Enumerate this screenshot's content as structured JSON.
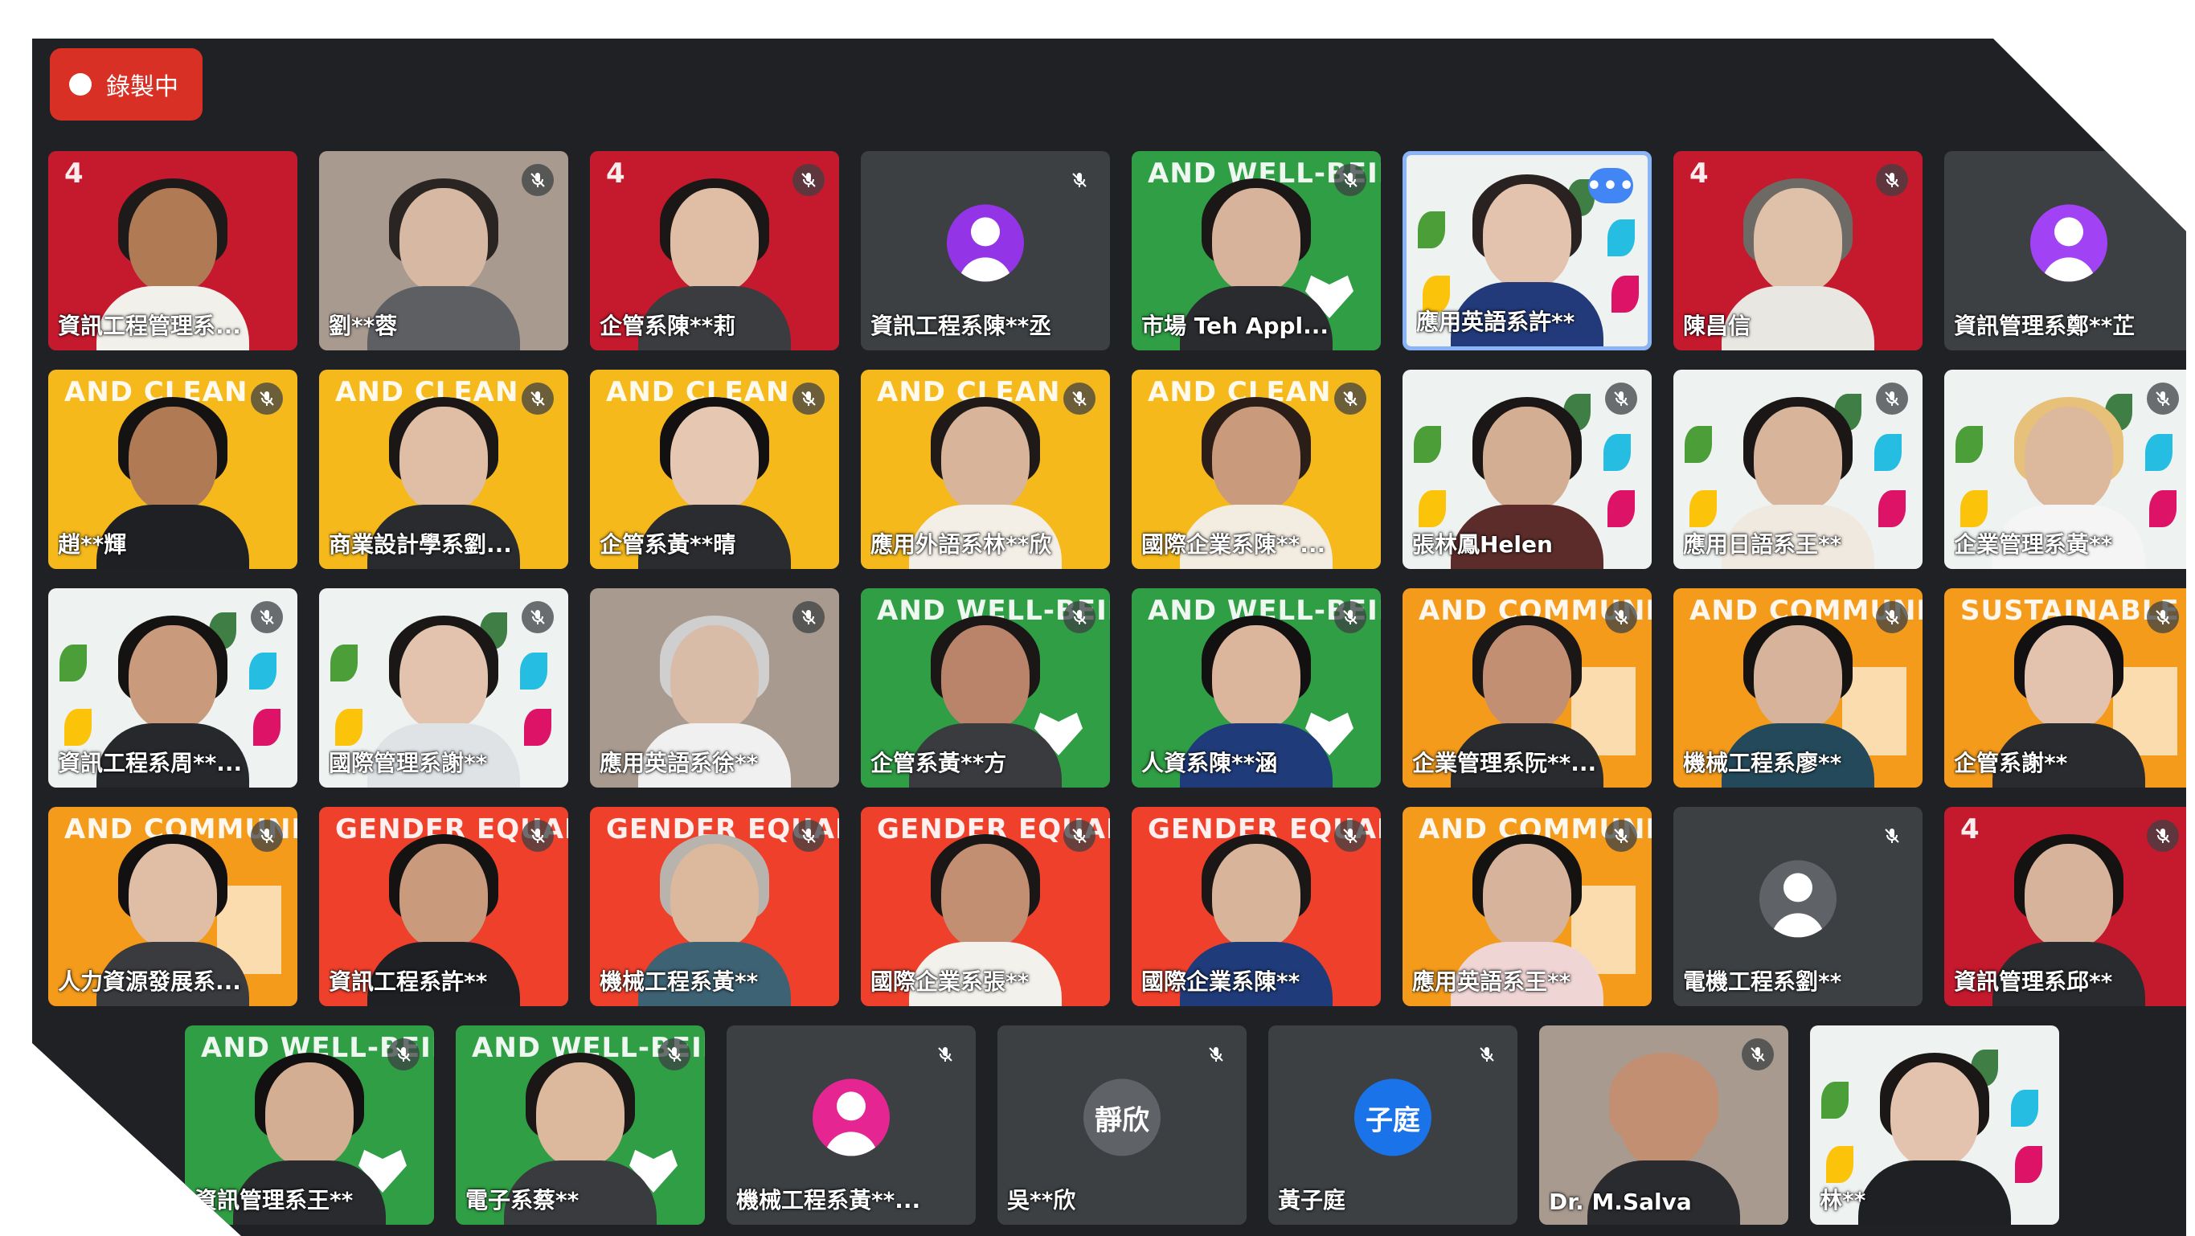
{
  "recording": {
    "label": "錄製中"
  },
  "colors": {
    "recording_red": "#d93025",
    "tile_gray": "#3c4043",
    "active_border": "#8ab4f8"
  },
  "participants": [
    {
      "name": "資訊工程管理系...",
      "bg": "red",
      "sdg": "4",
      "muted": false,
      "type": "video",
      "skin": "#b07a55",
      "hair": "#1d1a19",
      "shirt": "#f2f0ea"
    },
    {
      "name": "劉**蓉",
      "bg": "room",
      "sdg": "",
      "muted": true,
      "type": "video",
      "skin": "#d7b9a3",
      "hair": "#2a2523",
      "shirt": "#5d5f63"
    },
    {
      "name": "企管系陳**莉",
      "bg": "red",
      "sdg": "4",
      "muted": true,
      "type": "video",
      "skin": "#e0bea6",
      "hair": "#1b1717",
      "shirt": "#3b3c3f"
    },
    {
      "name": "資訊工程系陳**丞",
      "bg": "gray",
      "muted": true,
      "type": "avatar",
      "avatar_color": "#9334e6",
      "avatar_text": ""
    },
    {
      "name": "市場 Teh Appl...",
      "bg": "green",
      "sdg": "AND WELL-BEING",
      "muted": true,
      "type": "video",
      "skin": "#d6b39a",
      "hair": "#1b1717",
      "shirt": "#2a2b2e"
    },
    {
      "name": "應用英語系許**",
      "bg": "white",
      "sdg": "",
      "muted": false,
      "more": "•••",
      "active": true,
      "type": "video",
      "skin": "#e3c3ad",
      "hair": "#2a2220",
      "shirt": "#223a7a"
    },
    {
      "name": "陳昌信",
      "bg": "red",
      "sdg": "4",
      "muted": true,
      "type": "video",
      "skin": "#dfc0a8",
      "hair": "#6d6a66",
      "shirt": "#e9e7e1"
    },
    {
      "name": "資訊管理系鄭**芷",
      "bg": "gray",
      "muted": true,
      "type": "avatar",
      "avatar_color": "#a142f4",
      "avatar_text": ""
    },
    {
      "name": "趙**輝",
      "bg": "yellow",
      "sdg": "AND CLEAN",
      "muted": true,
      "type": "video",
      "skin": "#b07a55",
      "hair": "#151212",
      "shirt": "#1f2024"
    },
    {
      "name": "商業設計學系劉...",
      "bg": "yellow",
      "sdg": "AND CLEAN",
      "muted": true,
      "type": "video",
      "skin": "#e0bea6",
      "hair": "#1b1717",
      "shirt": "#2a2b2e"
    },
    {
      "name": "企管系黃**晴",
      "bg": "yellow",
      "sdg": "AND CLEAN",
      "muted": true,
      "type": "video",
      "skin": "#e6c7b2",
      "hair": "#121010",
      "shirt": "#2b2c2f"
    },
    {
      "name": "應用外語系林**欣",
      "bg": "yellow",
      "sdg": "AND CLEAN",
      "muted": true,
      "type": "video",
      "skin": "#d8b49a",
      "hair": "#1f1a18",
      "shirt": "#f4efe6"
    },
    {
      "name": "國際企業系陳**...",
      "bg": "yellow",
      "sdg": "AND CLEAN",
      "muted": true,
      "type": "video",
      "skin": "#c99a7c",
      "hair": "#2b1d17",
      "shirt": "#f3ece0"
    },
    {
      "name": "張林鳳Helen",
      "bg": "white",
      "sdg": "",
      "muted": true,
      "type": "video",
      "skin": "#d4ae93",
      "hair": "#1b1717",
      "shirt": "#5b2c2a"
    },
    {
      "name": "應用日語系王**",
      "bg": "white",
      "sdg": "",
      "muted": true,
      "type": "video",
      "skin": "#d8b49a",
      "hair": "#1b1717",
      "shirt": "#f0e9df"
    },
    {
      "name": "企業管理系黃**",
      "bg": "white",
      "sdg": "",
      "muted": true,
      "type": "video",
      "skin": "#dcb89d",
      "hair": "#e7c07a",
      "shirt": "#f5f5f5"
    },
    {
      "name": "資訊工程系周**...",
      "bg": "white",
      "sdg": "",
      "muted": true,
      "type": "video",
      "skin": "#c99a7c",
      "hair": "#151212",
      "shirt": "#26282c"
    },
    {
      "name": "國際管理系謝**",
      "bg": "white",
      "sdg": "",
      "muted": true,
      "type": "video",
      "skin": "#e3c3ad",
      "hair": "#1b1717",
      "shirt": "#dfe3e6"
    },
    {
      "name": "應用英語系徐**",
      "bg": "room",
      "sdg": "",
      "muted": true,
      "type": "video",
      "skin": "#d8bca8",
      "hair": "#cfcfcf",
      "shirt": "#f0f0f0"
    },
    {
      "name": "企管系黃**方",
      "bg": "green",
      "sdg": "AND WELL-BEING",
      "muted": true,
      "type": "video",
      "skin": "#b9846a",
      "hair": "#1b1717",
      "shirt": "#3a3b3f"
    },
    {
      "name": "人資系陳**涵",
      "bg": "green",
      "sdg": "AND WELL-BEING",
      "muted": true,
      "type": "video",
      "skin": "#dcb69c",
      "hair": "#121010",
      "shirt": "#1f3b7a"
    },
    {
      "name": "企業管理系阮**...",
      "bg": "orange",
      "sdg": "AND COMMUNITIES",
      "muted": true,
      "type": "video",
      "skin": "#c28f72",
      "hair": "#1b1717",
      "shirt": "#2a2b2e"
    },
    {
      "name": "機械工程系廖**",
      "bg": "orange",
      "sdg": "AND COMMUNITIES",
      "muted": true,
      "type": "video",
      "skin": "#d6b39a",
      "hair": "#151212",
      "shirt": "#24495a"
    },
    {
      "name": "企管系謝**",
      "bg": "orange",
      "sdg": "SUSTAINABLE",
      "muted": true,
      "type": "video",
      "skin": "#e3c3ad",
      "hair": "#121010",
      "shirt": "#2a2b2e"
    },
    {
      "name": "人力資源發展系...",
      "bg": "orange",
      "sdg": "AND COMMUNITIES",
      "muted": true,
      "type": "video",
      "skin": "#e0bea6",
      "hair": "#121010",
      "shirt": "#3a3b3f"
    },
    {
      "name": "資訊工程系許**",
      "bg": "genred",
      "sdg": "GENDER EQUALITY",
      "muted": true,
      "type": "video",
      "skin": "#c99a7c",
      "hair": "#151212",
      "shirt": "#1f2024"
    },
    {
      "name": "機械工程系黃**",
      "bg": "genred",
      "sdg": "GENDER EQUALITY",
      "muted": true,
      "type": "video",
      "skin": "#dcb89d",
      "hair": "#b8b3ad",
      "shirt": "#3d6274"
    },
    {
      "name": "國際企業系張**",
      "bg": "genred",
      "sdg": "GENDER EQUALITY",
      "muted": true,
      "type": "video",
      "skin": "#c28f72",
      "hair": "#1b1717",
      "shirt": "#f3f1ec"
    },
    {
      "name": "國際企業系陳**",
      "bg": "genred",
      "sdg": "GENDER EQUALITY",
      "muted": true,
      "type": "video",
      "skin": "#d8b49a",
      "hair": "#1b1717",
      "shirt": "#1f3b7a"
    },
    {
      "name": "應用英語系王**",
      "bg": "orange",
      "sdg": "AND COMMUNITIES",
      "muted": true,
      "type": "video",
      "skin": "#d6b39a",
      "hair": "#151212",
      "shirt": "#f0d5d5"
    },
    {
      "name": "電機工程系劉**",
      "bg": "gray",
      "muted": true,
      "type": "avatar",
      "avatar_color": "#5f6368",
      "avatar_text": ""
    },
    {
      "name": "資訊管理系邱**",
      "bg": "red",
      "sdg": "4",
      "muted": true,
      "type": "video",
      "skin": "#d6b39a",
      "hair": "#151212",
      "shirt": "#2a2b2e"
    },
    {
      "name": "資訊管理系王**",
      "bg": "green",
      "sdg": "AND WELL-BEING",
      "muted": true,
      "type": "video",
      "skin": "#d4ae93",
      "hair": "#121010",
      "shirt": "#2a2b2e"
    },
    {
      "name": "電子系蔡**",
      "bg": "green",
      "sdg": "AND WELL-BEING",
      "muted": true,
      "type": "video",
      "skin": "#dcb89d",
      "hair": "#1b1717",
      "shirt": "#3a3b3f"
    },
    {
      "name": "機械工程系黃**...",
      "bg": "gray",
      "muted": true,
      "type": "avatar",
      "avatar_color": "#e52592",
      "avatar_text": ""
    },
    {
      "name": "吳**欣",
      "bg": "gray",
      "muted": true,
      "type": "avatar",
      "avatar_color": "#5f6368",
      "avatar_text": "靜欣"
    },
    {
      "name": "黃子庭",
      "bg": "gray",
      "muted": true,
      "type": "avatar",
      "avatar_color": "#1a73e8",
      "avatar_text": "子庭"
    },
    {
      "name": "Dr. M.Salva",
      "bg": "room",
      "sdg": "",
      "muted": true,
      "type": "video",
      "skin": "#c28f72",
      "hair": "#c28f72",
      "shirt": "#2a2b2e"
    },
    {
      "name": "林**",
      "bg": "white",
      "sdg": "",
      "muted": false,
      "type": "video",
      "skin": "#e3c3ad",
      "hair": "#1b1717",
      "shirt": "#1f2024"
    }
  ]
}
